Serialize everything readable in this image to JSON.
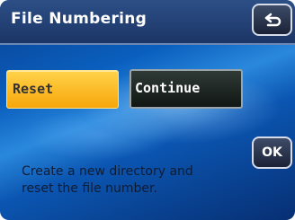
{
  "title_bar": {
    "title": "File Numbering",
    "back_icon": "return-arrow-icon"
  },
  "options": {
    "reset_label": "Reset",
    "continue_label": "Continue",
    "selected": "Reset"
  },
  "ok_label": "OK",
  "message": {
    "line1": "Create a new directory and",
    "line2": "reset the file number."
  },
  "colors": {
    "selected": "#f7a60a",
    "title_bar": "#1c3566",
    "background": "#0a5fbe"
  }
}
